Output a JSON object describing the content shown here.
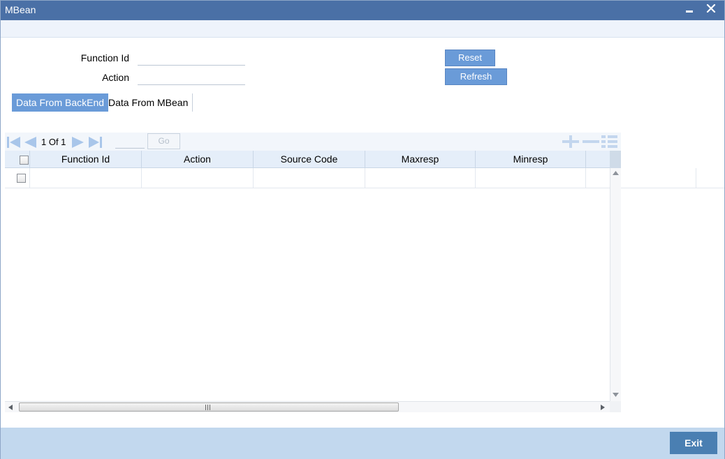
{
  "window": {
    "title": "MBean"
  },
  "form": {
    "function_id_label": "Function Id",
    "function_id_value": "",
    "action_label": "Action",
    "action_value": "",
    "reset_label": "Reset",
    "refresh_label": "Refresh"
  },
  "tabs": [
    {
      "label": "Data From BackEnd",
      "active": true
    },
    {
      "label": "Data From MBean",
      "active": false
    }
  ],
  "grid": {
    "page_info": "1 Of 1",
    "page_input": "",
    "go_label": "Go",
    "columns": [
      "Function Id",
      "Action",
      "Source Code",
      "Maxresp",
      "Minresp"
    ],
    "rows": [
      {
        "function_id": "",
        "action": "",
        "source_code": "",
        "maxresp": "",
        "minresp": ""
      }
    ]
  },
  "footer": {
    "exit_label": "Exit"
  },
  "colors": {
    "titlebar": "#4a70a6",
    "accent": "#6a9bd8",
    "footer": "#c2d8ee",
    "exit": "#4a7fb2"
  }
}
